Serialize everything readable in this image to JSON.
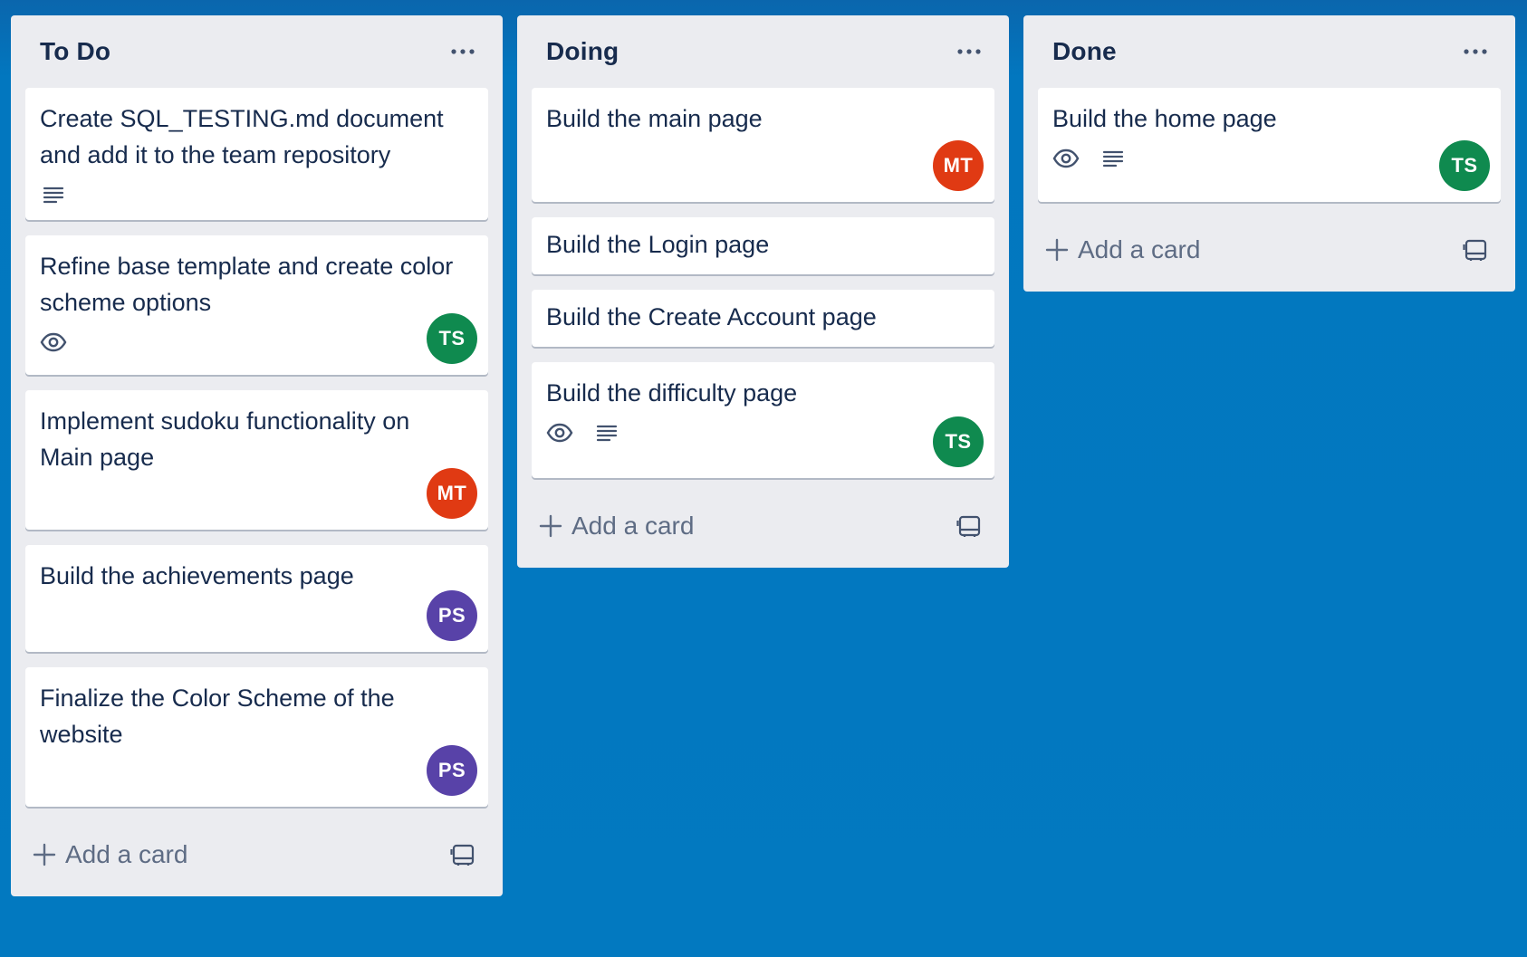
{
  "colors": {
    "board_background": "#0279c0",
    "list_background": "#ebecf0",
    "card_background": "#ffffff",
    "text_primary": "#172b4d",
    "text_muted": "#5e6c84"
  },
  "lists": [
    {
      "title": "To Do",
      "add_card_label": "Add a card",
      "cards": [
        {
          "title": "Create SQL_TESTING.md document and add it to the team repository",
          "badges": [
            "description-icon"
          ],
          "member": null
        },
        {
          "title": "Refine base template and create color scheme options",
          "badges": [
            "eye-icon"
          ],
          "member": {
            "initials": "TS",
            "color": "#0f8a4f"
          }
        },
        {
          "title": "Implement sudoku functionality on Main page",
          "badges": [],
          "member": {
            "initials": "MT",
            "color": "#e03a13"
          }
        },
        {
          "title": "Build the achievements page",
          "badges": [],
          "member": {
            "initials": "PS",
            "color": "#5842a8"
          }
        },
        {
          "title": "Finalize the Color Scheme of the website",
          "badges": [],
          "member": {
            "initials": "PS",
            "color": "#5842a8"
          }
        }
      ]
    },
    {
      "title": "Doing",
      "add_card_label": "Add a card",
      "cards": [
        {
          "title": "Build the main page",
          "badges": [],
          "member": {
            "initials": "MT",
            "color": "#e03a13"
          }
        },
        {
          "title": "Build the Login page",
          "badges": [],
          "member": null
        },
        {
          "title": "Build the Create Account page",
          "badges": [],
          "member": null
        },
        {
          "title": "Build the difficulty page",
          "badges": [
            "eye-icon",
            "description-icon"
          ],
          "member": {
            "initials": "TS",
            "color": "#0f8a4f"
          }
        }
      ]
    },
    {
      "title": "Done",
      "add_card_label": "Add a card",
      "cards": [
        {
          "title": "Build the home page",
          "badges": [
            "eye-icon",
            "description-icon"
          ],
          "member": {
            "initials": "TS",
            "color": "#0f8a4f"
          }
        }
      ]
    }
  ]
}
